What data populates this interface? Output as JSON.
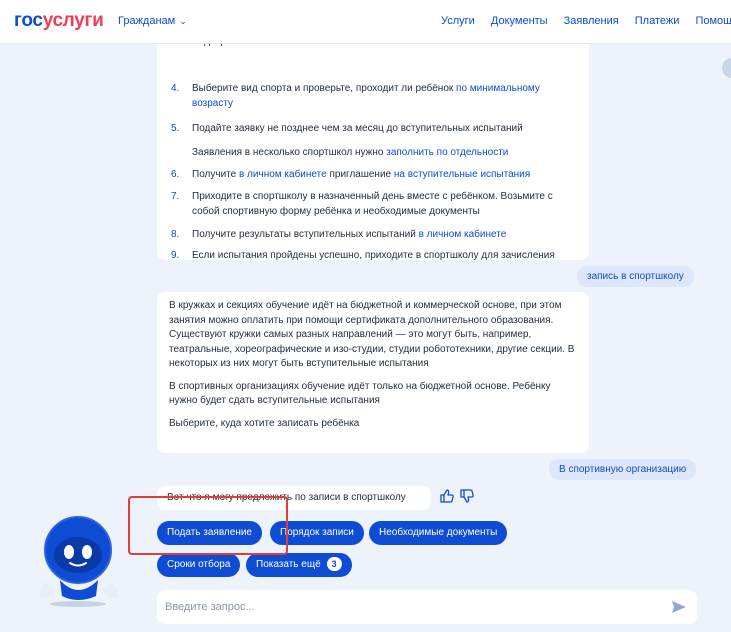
{
  "header": {
    "logo_part1": "гос",
    "logo_part2": "услуги",
    "citizens": "Гражданам",
    "nav": [
      "Услуги",
      "Документы",
      "Заявления",
      "Платежи",
      "Помощь"
    ]
  },
  "steps_partial_top": "медсправки",
  "steps": [
    {
      "num": "4.",
      "pre": "Выберите вид спорта и проверьте, проходит ли ребёнок ",
      "link": "по минимальному возрасту",
      "post": ""
    },
    {
      "num": "5.",
      "pre": "Подайте заявку не позднее чем за месяц до вступительных испытаний",
      "link": "",
      "post": ""
    },
    {
      "num": "",
      "pre": "Заявления в несколько спортшкол нужно ",
      "link": "заполнить по отдельности",
      "post": ""
    },
    {
      "num": "6.",
      "pre": "Получите ",
      "link": "в личном кабинете",
      "post": " приглашение ",
      "link2": "на вступительные испытания"
    },
    {
      "num": "7.",
      "pre": "Приходите в спортшколу в назначенный день вместе с ребёнком. Возьмите с собой спортивную форму ребёнка и необходимые документы",
      "link": "",
      "post": ""
    },
    {
      "num": "8.",
      "pre": "Получите результаты вступительных испытаний ",
      "link": "в личном кабинете",
      "post": ""
    },
    {
      "num": "9.",
      "pre": "Если испытания пройдены успешно, приходите в спортшколу для зачисления вместе с ребёнком. Возьмите с собой необходимые документы",
      "link": "",
      "post": ""
    }
  ],
  "user_msg_1": "запись в спортшколу",
  "info": {
    "p1": "В кружках и секциях обучение идёт на бюджетной и коммерческой основе, при этом занятия можно оплатить при помощи сертификата дополнительного образования. Существуют кружки самых разных направлений — это могут быть, например, театральные, хореографические и изо-студии, студии робототехники, другие секции. В некоторых из них могут быть вступительные испытания",
    "p2": "В спортивных организациях обучение идёт только на бюджетной основе. Ребёнку нужно будет сдать вступительные испытания",
    "p3": "Выберите, куда хотите записать ребёнка"
  },
  "user_msg_2": "В спортивную организацию",
  "bot_short": "Вот что я могу предложить по записи в спортшколу",
  "chips": {
    "apply": "Подать заявление",
    "order": "Порядок записи",
    "docs": "Необходимые документы",
    "deadlines": "Сроки отбора",
    "more": "Показать ещё",
    "more_count": "3"
  },
  "input": {
    "placeholder": "Введите запрос..."
  },
  "colors": {
    "brand_blue": "#0d4cd3",
    "brand_red": "#ee3f58",
    "highlight": "#e23d3d",
    "bg": "#edf2fb"
  }
}
